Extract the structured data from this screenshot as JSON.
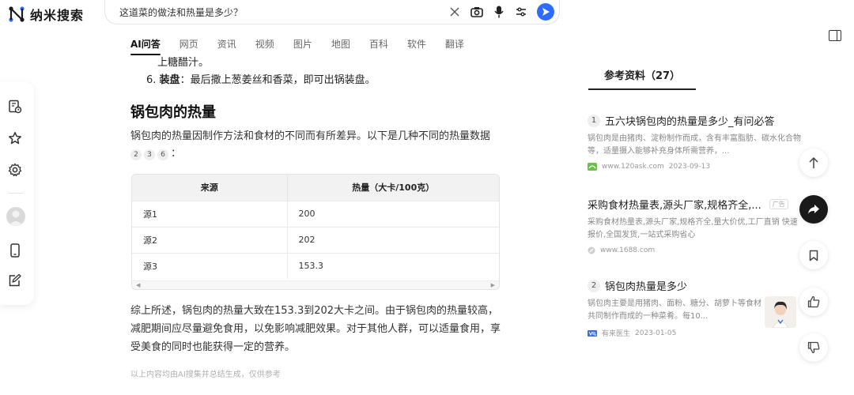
{
  "header": {
    "logo_text": "纳米搜索",
    "query": "这道菜的做法和热量是多少？"
  },
  "tabs": [
    {
      "label": "AI问答",
      "active": true
    },
    {
      "label": "网页"
    },
    {
      "label": "资讯"
    },
    {
      "label": "视频"
    },
    {
      "label": "图片"
    },
    {
      "label": "地图"
    },
    {
      "label": "百科"
    },
    {
      "label": "软件"
    },
    {
      "label": "翻译"
    }
  ],
  "content": {
    "step_tail": "上糖醋汁。",
    "step6_num": "6.",
    "step6_bold": "装盘",
    "step6_text": "：最后撒上葱姜丝和香菜，即可出锅装盘。",
    "section_title": "锅包肉的热量",
    "intro": "锅包肉的热量因制作方法和食材的不同而有所差异。以下是几种不同的热量数据",
    "intro_cites": [
      "2",
      "3",
      "6"
    ],
    "intro_colon": "：",
    "table": {
      "headers": [
        "来源",
        "热量（大卡/100克）"
      ],
      "rows": [
        [
          "源1",
          "200"
        ],
        [
          "源2",
          "202"
        ],
        [
          "源3",
          "153.3"
        ]
      ]
    },
    "summary": "综上所述，锅包肉的热量大致在153.3到202大卡之间。由于锅包肉的热量较高，减肥期间应尽量避免食用，以免影响减肥效果。对于其他人群，可以适量食用，享受美食的同时也能获得一定的营养。",
    "disclaimer": "以上内容均由AI搜集并总结生成，仅供参考"
  },
  "references": {
    "title": "参考资料（27）",
    "items": [
      {
        "num": "1",
        "title": "五六块锅包肉的热量是多少_有问必答",
        "desc": "锅包肉是由猪肉、淀粉制作而成，含有丰富脂肪、碳水化合物等，适量摄入能够补充身体所需营养，...",
        "source": "www.120ask.com",
        "date": "2023-09-13"
      },
      {
        "num": "",
        "title": "采购食材热量表,源头厂家,规格齐全,...",
        "ad_label": "广告",
        "desc": "采购食材热量表,源头厂家,规格齐全,量大价优,工厂直销 快速报价,全国发货,一站式采购省心",
        "source": "www.1688.com",
        "date": ""
      },
      {
        "num": "2",
        "title": "锅包肉热量是多少",
        "desc": "锅包肉主要是用猪肉、面粉、糖分、胡萝卜等食材共同制作而成的一种菜肴。每10...",
        "source": "有来医生",
        "date": "2023-01-05"
      }
    ]
  },
  "colors": {
    "accent": "#2f6bff",
    "text": "#222222",
    "muted": "#888888"
  }
}
